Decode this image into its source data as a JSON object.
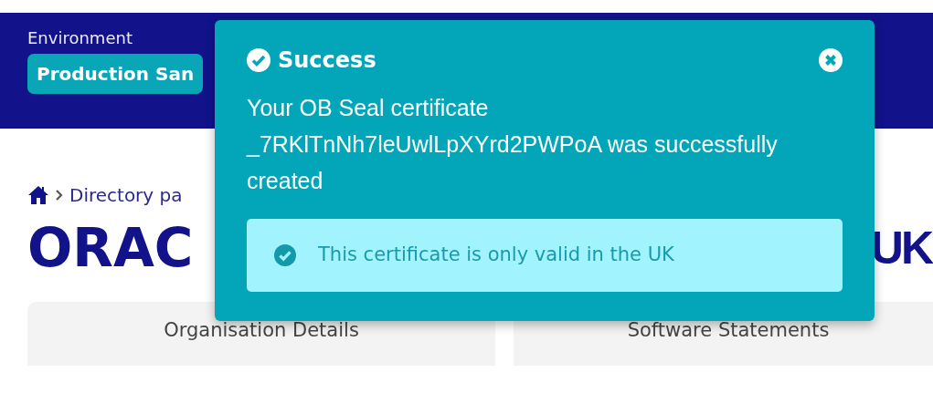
{
  "header": {
    "label": "Environment",
    "environment_badge": "Production San"
  },
  "breadcrumb": {
    "items": [
      "Directory pa"
    ]
  },
  "page_title": {
    "start": "ORAC",
    "end": "UK"
  },
  "cards": [
    {
      "title": "Organisation Details"
    },
    {
      "title": "Software Statements"
    }
  ],
  "toast": {
    "title": "Success",
    "message": "Your OB Seal certificate _7RKlTnNh7leUwlLpXYrd2PWPoA was successfully created",
    "notice": "This certificate is only valid in the UK"
  }
}
